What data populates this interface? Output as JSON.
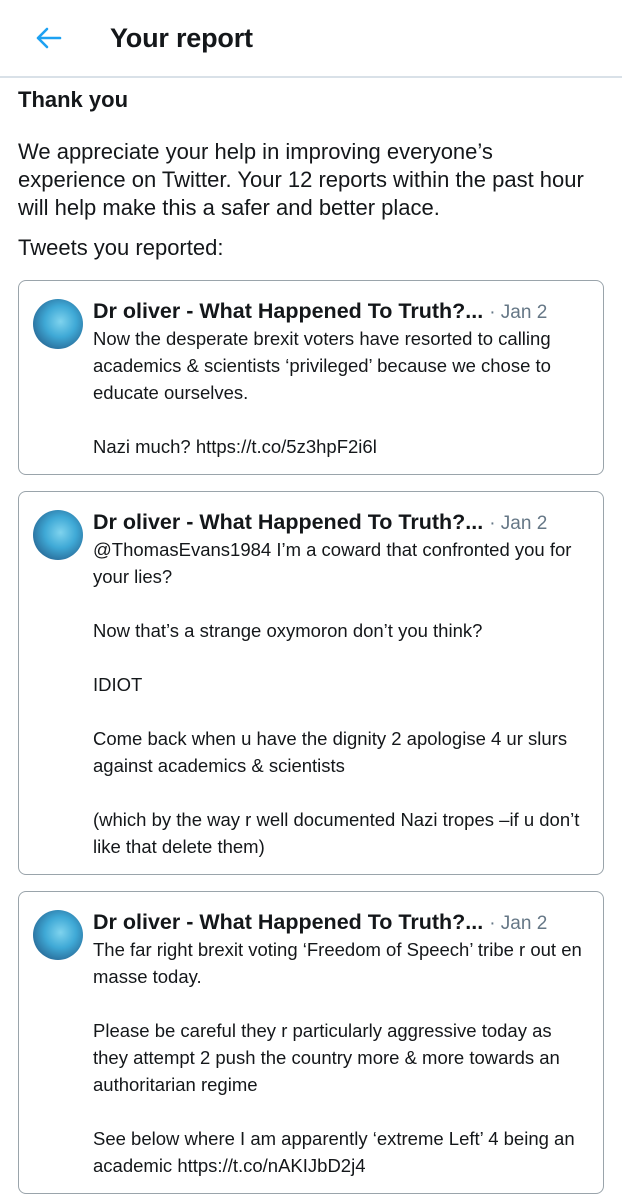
{
  "header": {
    "title": "Your report"
  },
  "message": {
    "thanks": "Thank you",
    "body": "We appreciate your help in improving everyone’s experience on Twitter. Your 12 reports within the past hour will help make this a safer and better place.",
    "reported_label": "Tweets you reported:"
  },
  "tweets": [
    {
      "author": "Dr oliver - What Happened To Truth?...",
      "date": "· Jan 2",
      "text": "Now the desperate brexit voters have resorted to calling academics & scientists ‘privileged’ because we chose to educate ourselves.\n\nNazi much? https://t.co/5z3hpF2i6l"
    },
    {
      "author": "Dr oliver - What Happened To Truth?...",
      "date": "· Jan 2",
      "text": "@ThomasEvans1984 I’m a coward that confronted you for your lies?\n\nNow that’s a strange oxymoron don’t you think?\n\nIDIOT\n\nCome back when u have the dignity 2 apologise 4 ur slurs against academics & scientists\n\n(which by the way r well documented Nazi tropes –if u don’t like that delete them)"
    },
    {
      "author": "Dr oliver - What Happened To Truth?...",
      "date": "· Jan 2",
      "text": "The far right brexit voting ‘Freedom of Speech’ tribe r out en masse today.\n\nPlease be careful they r particularly aggressive today as they attempt 2 push the country more & more towards an authoritarian regime\n\nSee below where I am apparently ‘extreme Left’ 4 being an academic https://t.co/nAKIJbD2j4"
    }
  ],
  "colors": {
    "accent": "#1da1f2",
    "muted": "#657786",
    "border": "#9aa4ab"
  }
}
